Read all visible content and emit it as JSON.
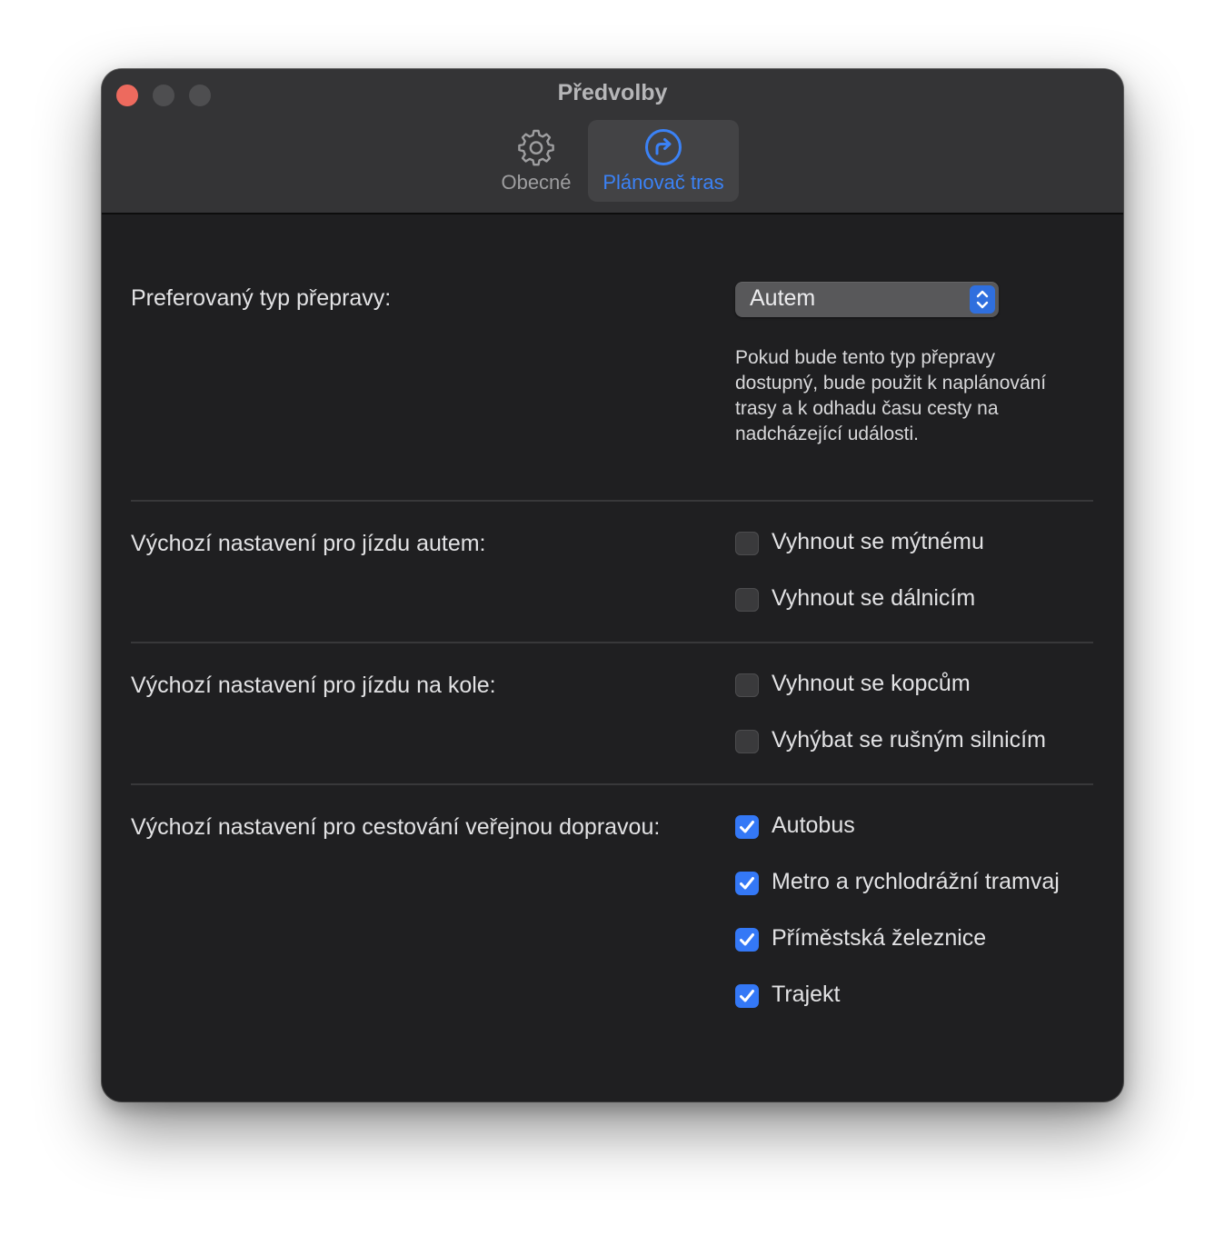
{
  "window": {
    "title": "Předvolby"
  },
  "toolbar": {
    "tabs": [
      {
        "label": "Obecné",
        "icon": "gear-icon",
        "selected": false
      },
      {
        "label": "Plánovač tras",
        "icon": "route-arrow-icon",
        "selected": true
      }
    ]
  },
  "transport": {
    "label": "Preferovaný typ přepravy:",
    "selected": "Autem",
    "help": "Pokud bude tento typ přepravy dostupný, bude použit k naplánování trasy a k odhadu času cesty na nadcházející události."
  },
  "driving": {
    "label": "Výchozí nastavení pro jízdu autem:",
    "options": [
      {
        "label": "Vyhnout se mýtnému",
        "checked": false
      },
      {
        "label": "Vyhnout se dálnicím",
        "checked": false
      }
    ]
  },
  "cycling": {
    "label": "Výchozí nastavení pro jízdu na kole:",
    "options": [
      {
        "label": "Vyhnout se kopcům",
        "checked": false
      },
      {
        "label": "Vyhýbat se rušným silnicím",
        "checked": false
      }
    ]
  },
  "transit": {
    "label": "Výchozí nastavení pro cestování veřejnou dopravou:",
    "options": [
      {
        "label": "Autobus",
        "checked": true
      },
      {
        "label": "Metro a rychlodrážní tramvaj",
        "checked": true
      },
      {
        "label": "Příměstská železnice",
        "checked": true
      },
      {
        "label": "Trajekt",
        "checked": true
      }
    ]
  },
  "colors": {
    "accent": "#3478f6",
    "window_bg": "#1f1f21",
    "titlebar_bg": "#343436",
    "close_button": "#ed6a5e"
  }
}
